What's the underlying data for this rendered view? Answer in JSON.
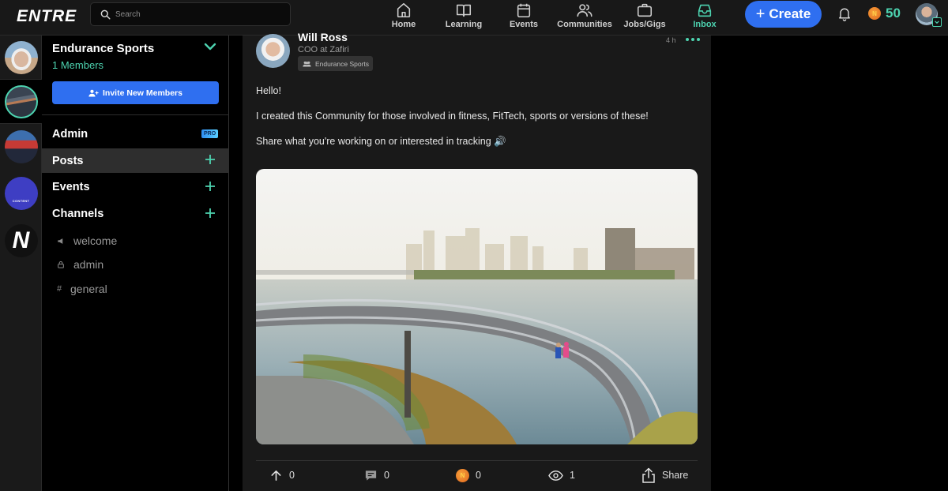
{
  "app": {
    "logo": "ENTRE"
  },
  "header": {
    "search_placeholder": "Search",
    "nav": [
      {
        "label": "Home",
        "icon": "home-icon",
        "active": false
      },
      {
        "label": "Learning",
        "icon": "book-icon",
        "active": false
      },
      {
        "label": "Events",
        "icon": "calendar-icon",
        "active": false
      },
      {
        "label": "Communities",
        "icon": "users-icon",
        "active": false
      },
      {
        "label": "Jobs/Gigs",
        "icon": "briefcase-icon",
        "active": false
      },
      {
        "label": "Inbox",
        "icon": "inbox-icon",
        "active": true
      }
    ],
    "create_label": "Create",
    "coin_symbol": "N",
    "coin_balance": "50"
  },
  "colors": {
    "accent": "#4dd3b0",
    "primary": "#2f6ff0",
    "coin": "#e0651d"
  },
  "community_strip": [
    {
      "name": "profile-avatar",
      "selected": false
    },
    {
      "name": "endurance-sports-avatar",
      "selected": true
    },
    {
      "name": "group-avatar",
      "selected": false
    },
    {
      "name": "content-avatar",
      "label": "CONTENT",
      "selected": false
    },
    {
      "name": "entre-n-avatar",
      "label": "N",
      "selected": false
    }
  ],
  "community": {
    "name": "Endurance Sports",
    "members": "1 Members",
    "invite_label": "Invite New Members",
    "admin_label": "Admin",
    "pro_badge": "PRO",
    "sections": [
      {
        "label": "Posts",
        "selected": true
      },
      {
        "label": "Events",
        "selected": false
      },
      {
        "label": "Channels",
        "selected": false
      }
    ],
    "channels": [
      {
        "label": "welcome",
        "icon": "megaphone-icon",
        "glyph": "📢"
      },
      {
        "label": "admin",
        "icon": "lock-icon",
        "glyph": "🔒"
      },
      {
        "label": "general",
        "icon": "hash-icon",
        "glyph": "#"
      }
    ]
  },
  "post": {
    "author": "Will Ross",
    "author_title": "COO at Zafiri",
    "community_tag": "Endurance Sports",
    "time": "4 h",
    "paragraphs": [
      "Hello!",
      "I created this Community for those involved in fitness, FitTech, sports or versions of these!",
      "Share what you're working on or interested in tracking 🔊"
    ],
    "image_alt": "Runners on a curved riverside walkway bridge with city skyline",
    "actions": {
      "upvotes": "0",
      "comments": "0",
      "tips": "0",
      "views": "1",
      "share_label": "Share"
    }
  }
}
